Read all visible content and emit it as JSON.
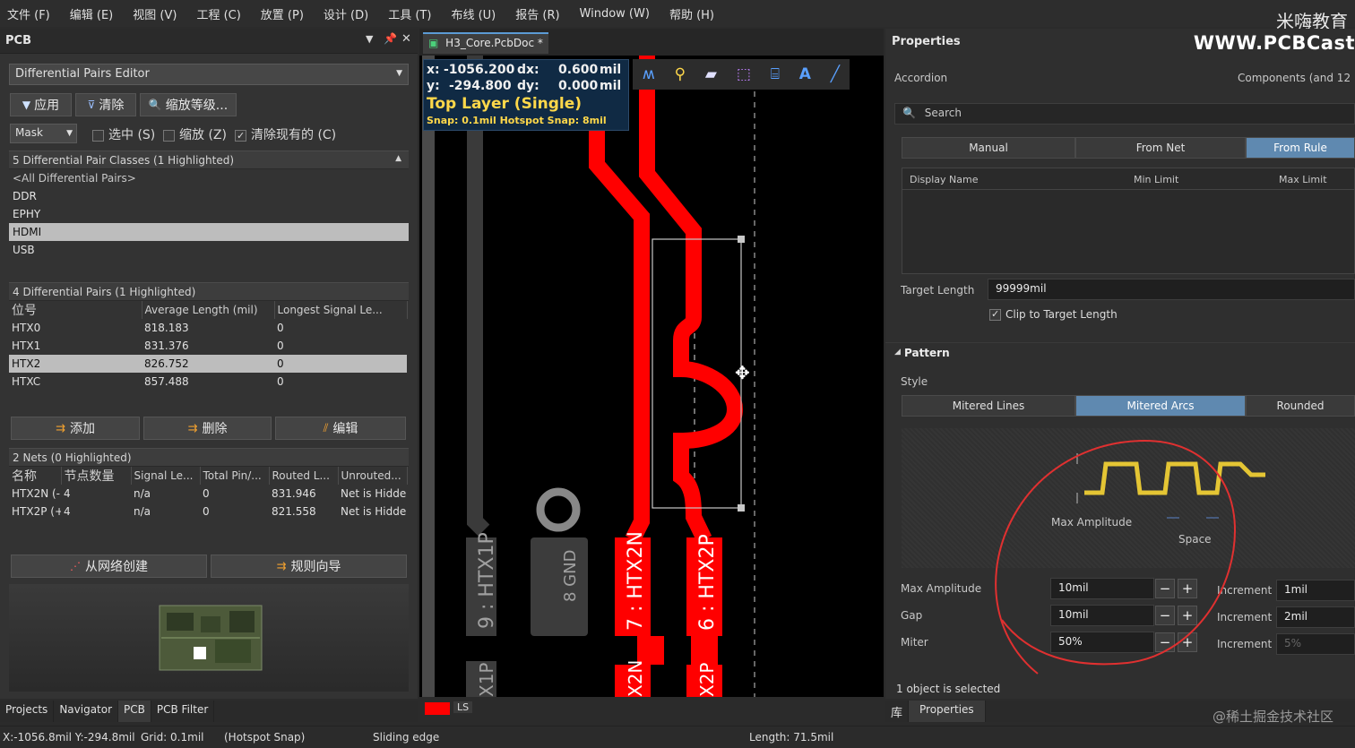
{
  "menu": [
    "文件 (F)",
    "编辑 (E)",
    "视图 (V)",
    "工程 (C)",
    "放置 (P)",
    "设计 (D)",
    "工具 (T)",
    "布线 (U)",
    "报告 (R)",
    "Window (W)",
    "帮助 (H)"
  ],
  "watermark": {
    "brand_cn": "米嗨教育",
    "brand_url": "WWW.PCBCast",
    "community": "@稀土掘金技术社区"
  },
  "left_panel": {
    "title": "PCB",
    "mode": "Differential Pairs Editor",
    "buttons": {
      "apply": "应用",
      "clear": "清除",
      "zoom": "缩放等级..."
    },
    "mask_label": "Mask",
    "checks": {
      "select": "选中 (S)",
      "zoom": "缩放 (Z)",
      "clear_existing": "清除现有的 (C)"
    },
    "classes": {
      "header": "5 Differential Pair Classes (1 Highlighted)",
      "items": [
        "<All Differential Pairs>",
        "DDR",
        "EPHY",
        "HDMI",
        "USB"
      ],
      "selected_index": 3
    },
    "pairs": {
      "header": "4 Differential Pairs (1 Highlighted)",
      "columns": [
        "位号",
        "Average Length (mil)",
        "Longest Signal Le..."
      ],
      "rows": [
        [
          "HTX0",
          "818.183",
          "0"
        ],
        [
          "HTX1",
          "831.376",
          "0"
        ],
        [
          "HTX2",
          "826.752",
          "0"
        ],
        [
          "HTXC",
          "857.488",
          "0"
        ]
      ],
      "selected_index": 2
    },
    "pair_buttons": {
      "add": "添加",
      "delete": "删除",
      "edit": "编辑"
    },
    "nets": {
      "header": "2 Nets (0 Highlighted)",
      "columns": [
        "名称",
        "节点数量",
        "Signal Le...",
        "Total Pin/...",
        "Routed L...",
        "Unrouted..."
      ],
      "rows": [
        [
          "HTX2N (-)",
          "4",
          "n/a",
          "0",
          "831.946",
          "Net is Hidde"
        ],
        [
          "HTX2P (+",
          "4",
          "n/a",
          "0",
          "821.558",
          "Net is Hidde"
        ]
      ]
    },
    "net_buttons": {
      "create_from_nets": "从网络创建",
      "rule_wizard": "规则向导"
    },
    "bottom_tabs": [
      "Projects",
      "Navigator",
      "PCB",
      "PCB Filter"
    ]
  },
  "document": {
    "tab": "H3_Core.PcbDoc *",
    "hud": {
      "x_label": "x:",
      "x_value": "-1056.200",
      "dx_label": "dx:",
      "dx_value": "0.600",
      "y_label": "y:",
      "y_value": "-294.800",
      "dy_label": "dy:",
      "dy_value": "0.000",
      "unit": "mil",
      "layer": "Top Layer (Single)",
      "snap": "Snap: 0.1mil Hotspot Snap: 8mil"
    },
    "pads": {
      "htx1p": "9 : HTX1P",
      "gnd": "8 GND",
      "htx2n": "7 : HTX2N",
      "htx2p": "6 : HTX2P",
      "bottom_left": "X1P",
      "bottom_mid": "X2N",
      "bottom_right": "X2P"
    },
    "layer_tab": "LS"
  },
  "properties": {
    "title": "Properties",
    "mode": "Accordion",
    "scope": "Components (and 12",
    "search_placeholder": "Search",
    "source_tabs": [
      "Manual",
      "From Net",
      "From Rule"
    ],
    "source_active": 2,
    "grid_columns": [
      "Display Name",
      "Min Limit",
      "Max Limit"
    ],
    "target_length_label": "Target Length",
    "target_length_value": "99999mil",
    "clip_label": "Clip to Target Length",
    "pattern_header": "Pattern",
    "style_label": "Style",
    "style_tabs": [
      "Mitered Lines",
      "Mitered Arcs",
      "Rounded"
    ],
    "style_active": 1,
    "preview_labels": {
      "amplitude": "Max Amplitude",
      "space": "Space"
    },
    "fields": [
      {
        "label": "Max Amplitude",
        "value": "10mil",
        "inc_label": "Increment",
        "inc_value": "1mil"
      },
      {
        "label": "Gap",
        "value": "10mil",
        "inc_label": "Increment",
        "inc_value": "2mil"
      },
      {
        "label": "Miter",
        "value": "50%",
        "inc_label": "Increment",
        "inc_value": "5%"
      }
    ],
    "selection_status": "1 object is selected",
    "bottom_tabs": [
      "库",
      "Properties"
    ]
  },
  "status": {
    "coords": "X:-1056.8mil Y:-294.8mil",
    "grid": "Grid: 0.1mil",
    "snap": "(Hotspot Snap)",
    "mode": "Sliding edge",
    "length": "Length: 71.5mil"
  },
  "colors": {
    "trace": "#ff0000",
    "accent": "#5f89b0",
    "hud_bg": "#102a44",
    "hud_layer": "#ffd84a",
    "annotation": "#e03030"
  }
}
